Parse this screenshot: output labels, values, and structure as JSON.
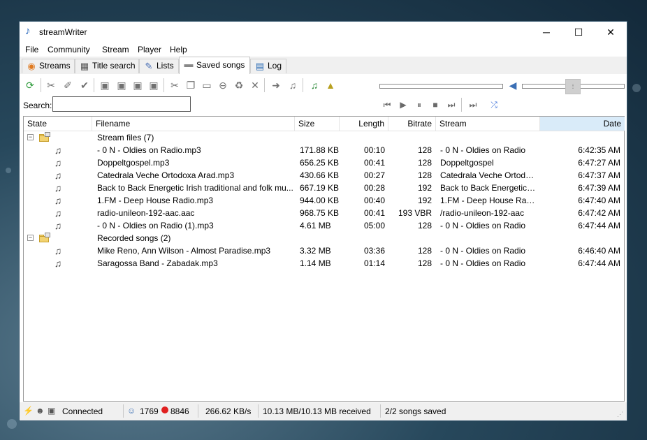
{
  "window": {
    "title": "streamWriter"
  },
  "menu": [
    "File",
    "Community",
    "Stream",
    "Player",
    "Help"
  ],
  "tabs": [
    {
      "label": "Streams",
      "icon": "radio-icon"
    },
    {
      "label": "Title search",
      "icon": "building-icon"
    },
    {
      "label": "Lists",
      "icon": "notepad-icon"
    },
    {
      "label": "Saved songs",
      "icon": "drive-icon",
      "active": true
    },
    {
      "label": "Log",
      "icon": "book-icon"
    }
  ],
  "search": {
    "label": "Search:",
    "value": ""
  },
  "columns": [
    "State",
    "Filename",
    "Size",
    "Length",
    "Bitrate",
    "Stream",
    "Date"
  ],
  "groups": [
    {
      "label": "Stream files (7)",
      "expander": "−",
      "rows": [
        {
          "filename": "- 0 N - Oldies on Radio.mp3",
          "size": "171.88 KB",
          "length": "00:10",
          "bitrate": "128",
          "stream": "- 0 N - Oldies on Radio",
          "date": "6:42:35 AM"
        },
        {
          "filename": "Doppeltgospel.mp3",
          "size": "656.25 KB",
          "length": "00:41",
          "bitrate": "128",
          "stream": "Doppeltgospel",
          "date": "6:47:27 AM"
        },
        {
          "filename": "Catedrala Veche Ortodoxa Arad.mp3",
          "size": "430.66 KB",
          "length": "00:27",
          "bitrate": "128",
          "stream": "Catedrala Veche Ortodo...",
          "date": "6:47:37 AM"
        },
        {
          "filename": "Back to Back Energetic Irish traditional and folk mu...",
          "size": "667.19 KB",
          "length": "00:28",
          "bitrate": "192",
          "stream": "Back to Back Energetic Ir...",
          "date": "6:47:39 AM"
        },
        {
          "filename": "1.FM - Deep House Radio.mp3",
          "size": "944.00 KB",
          "length": "00:40",
          "bitrate": "192",
          "stream": "1.FM - Deep House Radio",
          "date": "6:47:40 AM"
        },
        {
          "filename": "radio-unileon-192-aac.aac",
          "size": "968.75 KB",
          "length": "00:41",
          "bitrate": "193 VBR",
          "stream": "/radio-unileon-192-aac",
          "date": "6:47:42 AM"
        },
        {
          "filename": "- 0 N - Oldies on Radio (1).mp3",
          "size": "4.61 MB",
          "length": "05:00",
          "bitrate": "128",
          "stream": "- 0 N - Oldies on Radio",
          "date": "6:47:44 AM"
        }
      ]
    },
    {
      "label": "Recorded songs (2)",
      "expander": "−",
      "rows": [
        {
          "filename": "Mike Reno, Ann Wilson - Almost Paradise.mp3",
          "size": "3.32 MB",
          "length": "03:36",
          "bitrate": "128",
          "stream": "- 0 N - Oldies on Radio",
          "date": "6:46:40 AM"
        },
        {
          "filename": "Saragossa Band - Zabadak.mp3",
          "size": "1.14 MB",
          "length": "01:14",
          "bitrate": "128",
          "stream": "- 0 N - Oldies on Radio",
          "date": "6:47:44 AM"
        }
      ]
    }
  ],
  "status": {
    "connection": "Connected",
    "clients": "1769",
    "recordings": "8846",
    "speed": "266.62 KB/s",
    "received": "10.13 MB/10.13 MB received",
    "saved": "2/2 songs saved"
  },
  "player": {
    "volume": 0.5,
    "position": 0
  },
  "colors": {
    "accent": "#1b5fb8",
    "sorted_header": "#d9ebf9",
    "record_dot": "#e02020"
  }
}
